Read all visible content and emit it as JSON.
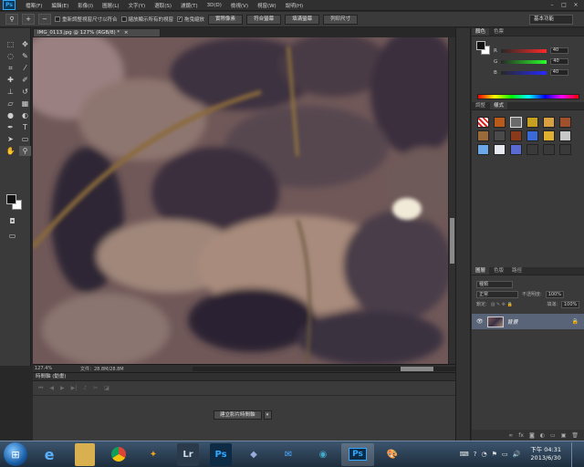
{
  "app": {
    "logo": "Ps"
  },
  "menu": [
    "檔案(F)",
    "編輯(E)",
    "影像(I)",
    "圖層(L)",
    "文字(Y)",
    "選取(S)",
    "濾鏡(T)",
    "3D(D)",
    "檢視(V)",
    "視窗(W)",
    "說明(H)"
  ],
  "window_controls": [
    "–",
    "□",
    "×"
  ],
  "options": {
    "tool_icon": "zoom-icon",
    "resize_windows": "重新調整視窗尺寸以符合",
    "zoom_all": "縮放顯示所有的視窗",
    "scrubby_zoom": "拖曳縮放",
    "scrubby_checked": "✓",
    "btn_actual": "實際像素",
    "btn_fit": "符合螢幕",
    "btn_fill": "填滿螢幕",
    "btn_print": "列印尺寸",
    "workspace": "基本功能"
  },
  "document": {
    "tab_title": "IMG_0113.jpg @ 127% (RGB/8) *",
    "close": "×",
    "zoom_readout": "127.4%",
    "doc_size": "文件：28.8M/28.8M"
  },
  "timeline": {
    "title": "時間軸 (動畫)",
    "create_button": "建立影片時間軸"
  },
  "panels": {
    "color_tab": "顏色",
    "swatches_tab": "色票",
    "channels": [
      {
        "label": "R",
        "value": "40",
        "color": "#e03a3a"
      },
      {
        "label": "G",
        "value": "40",
        "color": "#3ac03a"
      },
      {
        "label": "B",
        "value": "40",
        "color": "#3a6ae0"
      }
    ],
    "adjust_tab": "調整",
    "styles_tab": "樣式",
    "layers_tab": "圖層",
    "channels_tab": "色版",
    "paths_tab": "路徑",
    "kind_filter": "種類",
    "blend_mode": "正常",
    "opacity_label": "不透明度:",
    "opacity_value": "100%",
    "lock_label": "鎖定:",
    "fill_label": "填滿:",
    "fill_value": "100%",
    "layer_name": "背景"
  },
  "taskbar": {
    "apps": [
      "ie",
      "folder",
      "chrome",
      "photo-viewer",
      "Lr",
      "Ps",
      "bridge",
      "mail",
      "browser",
      "Ps",
      "paint"
    ],
    "time": "下午 04:31",
    "date": "2013/6/30"
  },
  "colors": {
    "accent": "#31a8ff",
    "layer_selected": "#5a6478"
  }
}
